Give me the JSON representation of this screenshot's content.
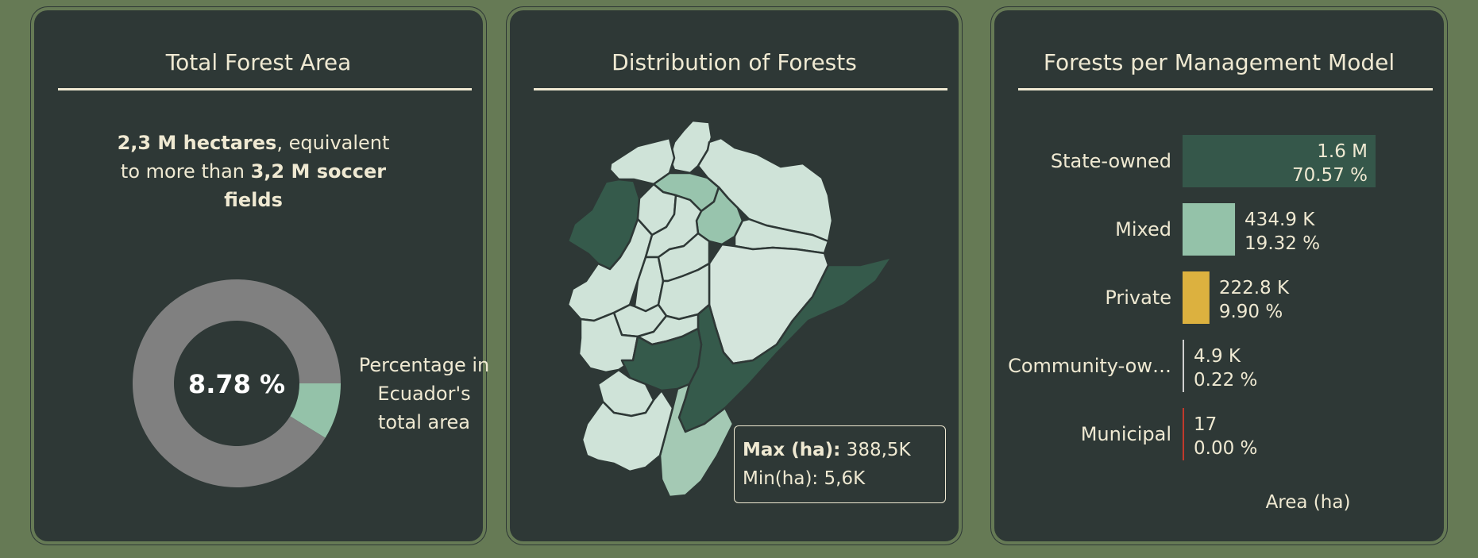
{
  "panels": {
    "total": {
      "title": "Total Forest Area",
      "summary_bold_1": "2,3 M hectares",
      "summary_text_1": ", equivalent to more than ",
      "summary_bold_2": "3,2 M soccer fields",
      "donut_center": "8.78 %",
      "donut_caption_1": "Percentage in",
      "donut_caption_2": "Ecuador's",
      "donut_caption_3": "total area"
    },
    "distribution": {
      "title": "Distribution of Forests",
      "legend_max_label": "Max (ha):",
      "legend_max_value": " 388,5K",
      "legend_min_label": "Min(ha):",
      "legend_min_value": " 5,6K"
    },
    "management": {
      "title": "Forests per Management Model"
    }
  },
  "colors": {
    "background": "#667a55",
    "panel": "#2e3836",
    "text": "#efe9d2",
    "donut_rest": "#808080",
    "donut_share": "#94c2a9",
    "state_owned": "#35574a",
    "mixed": "#94c2a9",
    "private": "#dcb13f",
    "community": "#cfcfcf",
    "municipal": "#c0392b",
    "map_dark": "#355a4b",
    "map_mid": "#98c4ad",
    "map_light": "#cfe3d8"
  },
  "chart_data": [
    {
      "type": "pie",
      "title": "",
      "slices": [
        {
          "name": "",
          "value": 8.78
        },
        {
          "name": "",
          "value": 91.22
        }
      ]
    },
    {
      "type": "bar",
      "orientation": "horizontal",
      "title": "",
      "xlabel": "Area (ha)",
      "categories": [
        "State-owned",
        "Mixed",
        "Private",
        "Community-ow…",
        "Municipal"
      ],
      "values": [
        1600000,
        434900,
        222800,
        4900,
        17
      ],
      "value_labels": [
        "1.6 M",
        "434.9 K",
        "222.8 K",
        "4.9 K",
        "17"
      ],
      "percent_labels": [
        "70.57 %",
        "19.32 %",
        "9.90 %",
        "0.22 %",
        "0.00 %"
      ],
      "xlim": [
        0,
        1600000
      ]
    }
  ]
}
